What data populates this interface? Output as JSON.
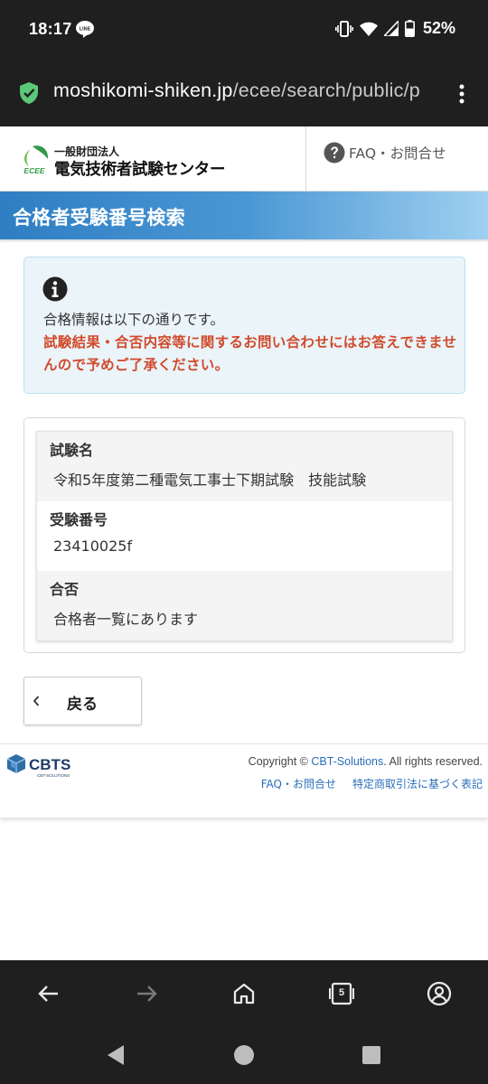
{
  "status_bar": {
    "time": "18:17",
    "battery": "52%",
    "icons": [
      "line-icon",
      "vibrate-icon",
      "wifi-icon",
      "signal-icon",
      "battery-icon"
    ]
  },
  "browser": {
    "url_host": "moshikomi-shiken.jp",
    "url_path": "/ecee/search/public/p",
    "tab_count": "5",
    "toolbar_icons": [
      "back-arrow-icon",
      "forward-arrow-icon",
      "home-icon",
      "tabs-icon",
      "account-icon"
    ]
  },
  "header": {
    "org_sub": "一般財団法人",
    "org_name": "電気技術者試験センター",
    "logo_text": "ECEE",
    "faq_label": "FAQ・お問合せ"
  },
  "page": {
    "title": "合格者受験番号検索"
  },
  "alert": {
    "text": "合格情報は以下の通りです。",
    "warning": "試験結果・合否内容等に関するお問い合わせにはお答えできませんので予めご了承ください。"
  },
  "result": {
    "rows": [
      {
        "label": "試験名",
        "value": "令和5年度第二種電気工事士下期試験　技能試験"
      },
      {
        "label": "受験番号",
        "value": "23410025f"
      },
      {
        "label": "合否",
        "value": "合格者一覧にあります"
      }
    ]
  },
  "back_button": {
    "label": "戻る"
  },
  "footer": {
    "logo_text": "CBTS",
    "logo_sub": "CBT-SOLUTIONS",
    "copyright_prefix": "Copyright © ",
    "copyright_link": "CBT-Solutions",
    "copyright_suffix": ". All rights reserved.",
    "links": [
      "FAQ・お問合せ",
      "特定商取引法に基づく表記"
    ]
  },
  "colors": {
    "brand_blue": "#2f7ec3",
    "warning_red": "#d24a2c",
    "link_blue": "#2a6ebb",
    "alert_bg": "#eaf4f9"
  }
}
